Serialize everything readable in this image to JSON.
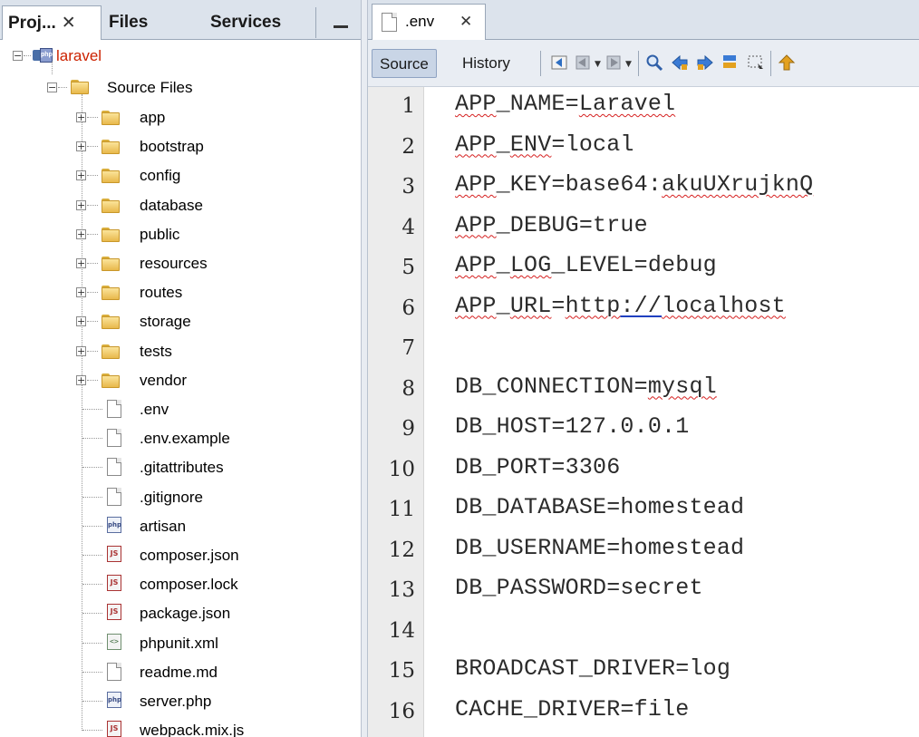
{
  "projects_panel": {
    "tabs": [
      {
        "label": "Proj...",
        "close": "✕"
      },
      {
        "label": "Files"
      },
      {
        "label": "Services"
      }
    ],
    "tree": {
      "root": "laravel",
      "source_files": "Source Files",
      "folders": [
        "app",
        "bootstrap",
        "config",
        "database",
        "public",
        "resources",
        "routes",
        "storage",
        "tests",
        "vendor"
      ],
      "files": [
        ".env",
        ".env.example",
        ".gitattributes",
        ".gitignore",
        "artisan",
        "composer.json",
        "composer.lock",
        "package.json",
        "phpunit.xml",
        "readme.md",
        "server.php",
        "webpack.mix.js"
      ],
      "file_icons": [
        "file-icon",
        "file-icon",
        "file-icon",
        "file-icon",
        "php-file-icon",
        "js-file-icon",
        "js-file-icon",
        "js-file-icon",
        "xml-file-icon",
        "file-icon",
        "php-file-icon",
        "js-file-icon"
      ]
    }
  },
  "editor": {
    "tab": {
      "label": ".env",
      "close": "✕"
    },
    "toolbar": {
      "source": "Source",
      "history": "History"
    },
    "lines": [
      {
        "n": "1",
        "text": "APP_NAME=Laravel"
      },
      {
        "n": "2",
        "text": "APP_ENV=local"
      },
      {
        "n": "3",
        "text": "APP_KEY=base64:akuUXrujknQ"
      },
      {
        "n": "4",
        "text": "APP_DEBUG=true"
      },
      {
        "n": "5",
        "text": "APP_LOG_LEVEL=debug"
      },
      {
        "n": "6",
        "text": "APP_URL=http://localhost"
      },
      {
        "n": "7",
        "text": ""
      },
      {
        "n": "8",
        "text": "DB_CONNECTION=mysql"
      },
      {
        "n": "9",
        "text": "DB_HOST=127.0.0.1"
      },
      {
        "n": "10",
        "text": "DB_PORT=3306"
      },
      {
        "n": "11",
        "text": "DB_DATABASE=homestead"
      },
      {
        "n": "12",
        "text": "DB_USERNAME=homestead"
      },
      {
        "n": "13",
        "text": "DB_PASSWORD=secret"
      },
      {
        "n": "14",
        "text": ""
      },
      {
        "n": "15",
        "text": "BROADCAST_DRIVER=log"
      },
      {
        "n": "16",
        "text": "CACHE_DRIVER=file"
      }
    ]
  },
  "colors": {
    "root_label": "#cc2200",
    "squiggle": "#d62020",
    "selection": "#c9d5e6"
  }
}
